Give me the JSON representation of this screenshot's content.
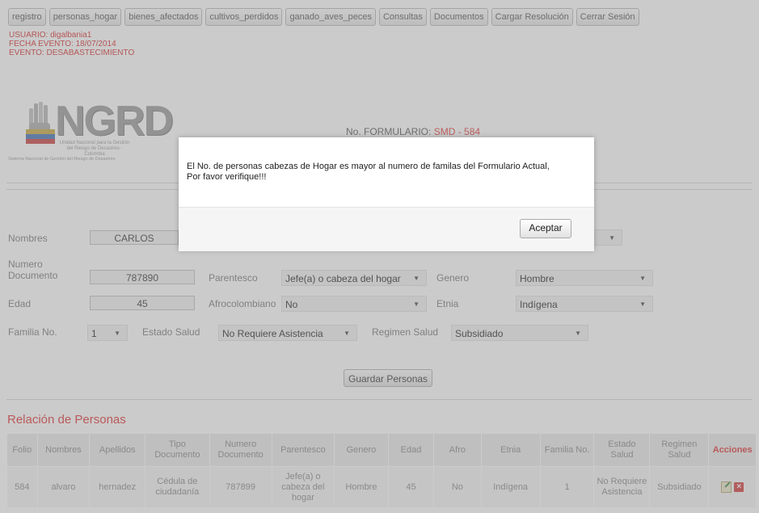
{
  "nav": [
    "registro",
    "personas_hogar",
    "bienes_afectados",
    "cultivos_perdidos",
    "ganado_aves_peces",
    "Consultas",
    "Documentos",
    "Cargar Resolución",
    "Cerrar Sesión"
  ],
  "session": {
    "usuario": "USUARIO: digalbania1",
    "fecha": "FECHA EVENTO: 18/07/2014",
    "evento": "EVENTO: DESABASTECIMIENTO"
  },
  "logo": {
    "title": "NGRD",
    "sub1": "Unidad Nacional para la Gestión del Riesgo de Desastres - Colombia",
    "sub2": "Sistema Nacional de Gestión del Riesgo de Desastres"
  },
  "formulario": {
    "label": "No. FORMULARIO:",
    "code": "SMD  -  584"
  },
  "form": {
    "nombres_label": "Nombres",
    "nombres_value": "CARLOS",
    "numero_label": "Numero Documento",
    "numero_value": "787890",
    "parentesco_label": "Parentesco",
    "parentesco_value": "Jefe(a) o cabeza del hogar",
    "genero_label": "Genero",
    "genero_value": "Hombre",
    "edad_label": "Edad",
    "edad_value": "45",
    "afro_label": "Afrocolombiano",
    "afro_value": "No",
    "etnia_label": "Etnia",
    "etnia_value": "Indígena",
    "familia_label": "Familia No.",
    "familia_value": "1",
    "estado_label": "Estado Salud",
    "estado_value": "No Requiere Asistencia",
    "regimen_label": "Regimen Salud",
    "regimen_value": "Subsidiado",
    "guardar": "Guardar Personas"
  },
  "relacion_title": "Relación de Personas",
  "table": {
    "headers": [
      "Folio",
      "Nombres",
      "Apellidos",
      "Tipo Documento",
      "Numero Documento",
      "Parentesco",
      "Genero",
      "Edad",
      "Afro",
      "Etnia",
      "Familia No.",
      "Estado Salud",
      "Regimen Salud",
      "Acciones"
    ],
    "row": [
      "584",
      "alvaro",
      "hernadez",
      "Cédula de ciudadanía",
      "787899",
      "Jefe(a) o cabeza del hogar",
      "Hombre",
      "45",
      "No",
      "Indígena",
      "1",
      "No Requiere Asistencia",
      "Subsidiado"
    ]
  },
  "dialog": {
    "message_line1": "El No. de personas cabezas de Hogar es mayor al numero de familas del Formulario Actual,",
    "message_line2": "Por favor verifique!!!",
    "ok": "Aceptar"
  },
  "colors": {
    "accent_red": "#e03131",
    "overlay": "rgba(140,140,140,0.45)"
  },
  "icons": {
    "edit": "edit-icon",
    "delete": "delete-icon",
    "dropdown": "chevron-down-icon"
  }
}
